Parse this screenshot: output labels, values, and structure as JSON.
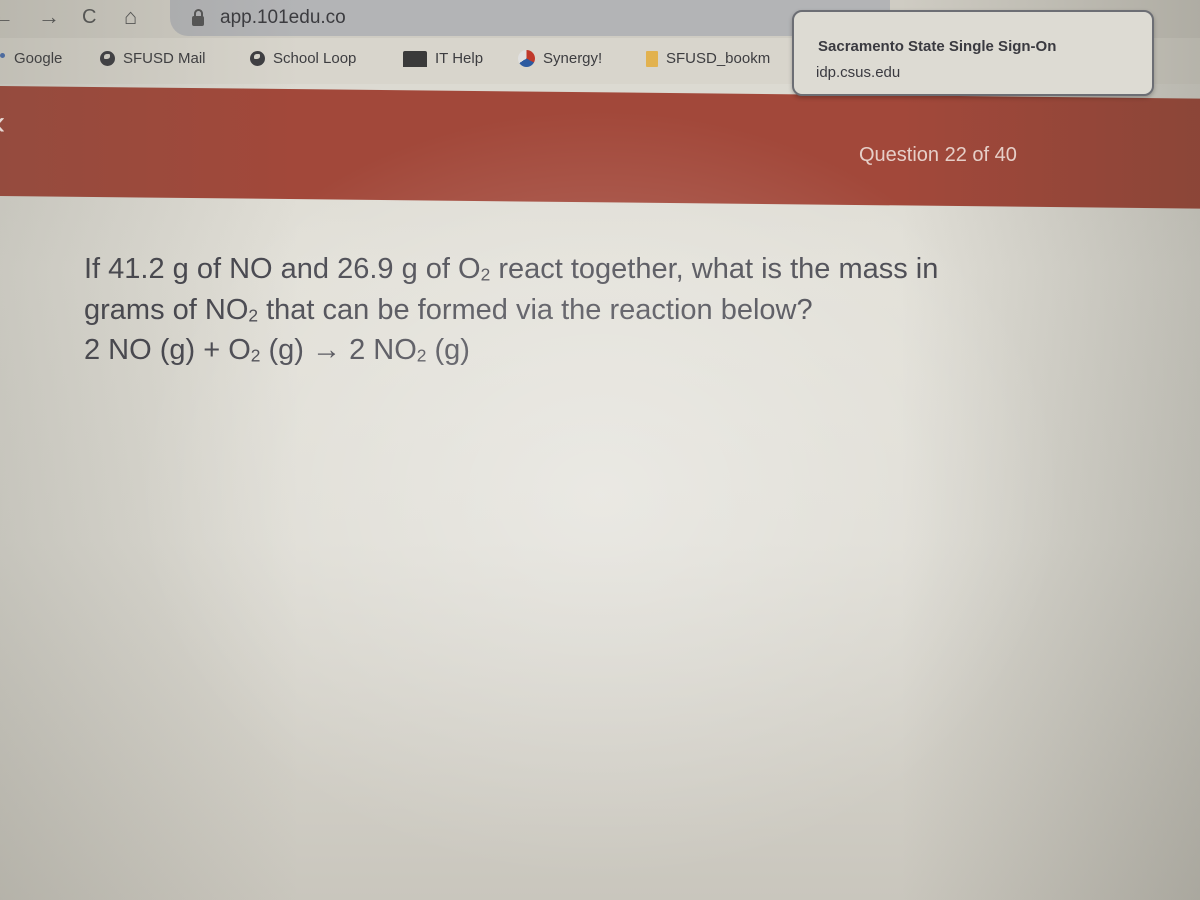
{
  "browser": {
    "url": "app.101edu.co",
    "nav": {
      "back": "←",
      "forward": "→",
      "reload": "C",
      "home": "⌂"
    },
    "bookmarks": [
      {
        "label": "Google",
        "icon": "google-icon"
      },
      {
        "label": "SFUSD Mail",
        "icon": "globe-icon"
      },
      {
        "label": "School Loop",
        "icon": "globe-icon"
      },
      {
        "label": "IT Help",
        "icon": "laptop-icon"
      },
      {
        "label": "Synergy!",
        "icon": "synergy-icon"
      },
      {
        "label": "SFUSD_bookm",
        "icon": "folder-icon"
      }
    ],
    "tooltip": {
      "title": "Sacramento State Single Sign-On",
      "url": "idp.csus.edu"
    }
  },
  "header": {
    "back_icon": "‹",
    "question_counter": "Question 22 of 40",
    "accent_color": "#a2483a"
  },
  "question": {
    "line1_a": "If 41.2 g of NO and 26.9 g of O",
    "line1_sub": "2",
    "line1_b": " react together, what is the mass in",
    "line2_a": "grams of NO",
    "line2_sub": "2",
    "line2_b": " that can be formed via the reaction below?",
    "eq_a": "2 NO (g) + O",
    "eq_sub1": "2",
    "eq_b": " (g) → 2 NO",
    "eq_sub2": "2",
    "eq_c": " (g)"
  }
}
